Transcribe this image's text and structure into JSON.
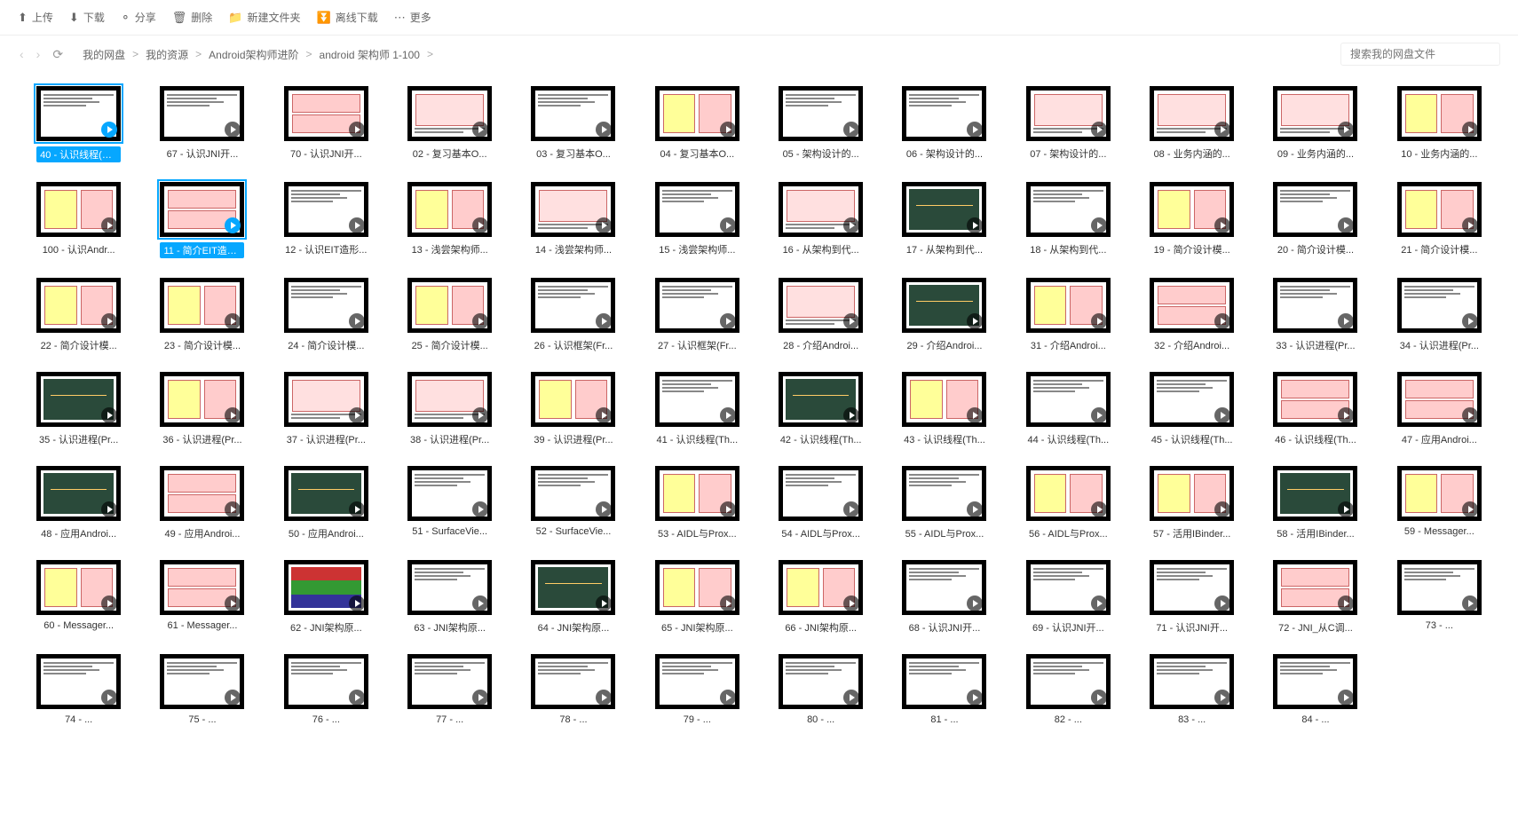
{
  "toolbar": {
    "upload": "上传",
    "download": "下载",
    "share": "分享",
    "delete": "删除",
    "new_folder": "新建文件夹",
    "offline": "离线下载",
    "more": "更多"
  },
  "breadcrumb": [
    "我的网盘",
    "我的资源",
    "Android架构师进阶",
    "android 架构师 1-100"
  ],
  "search_placeholder": "搜索我的网盘文件",
  "selected": [
    "40 - 认识线程(Th...",
    "11 - 简介EIT造形..."
  ],
  "files": [
    {
      "n": "40 - 认识线程(Th...",
      "t": "a",
      "sel": true
    },
    {
      "n": "67 - 认识JNI开...",
      "t": "a"
    },
    {
      "n": "70 - 认识JNI开...",
      "t": "b"
    },
    {
      "n": "02 - 复习基本O...",
      "t": "c"
    },
    {
      "n": "03 - 复习基本O...",
      "t": "a"
    },
    {
      "n": "04 - 复习基本O...",
      "t": "d"
    },
    {
      "n": "05 - 架构设计的...",
      "t": "a"
    },
    {
      "n": "06 - 架构设计的...",
      "t": "a"
    },
    {
      "n": "07 - 架构设计的...",
      "t": "c"
    },
    {
      "n": "08 - 业务内涵的...",
      "t": "c"
    },
    {
      "n": "09 - 业务内涵的...",
      "t": "c"
    },
    {
      "n": "10 - 业务内涵的...",
      "t": "d"
    },
    {
      "n": "100 - 认识Andr...",
      "t": "d"
    },
    {
      "n": "11 - 简介EIT造形...",
      "t": "b",
      "sel": true
    },
    {
      "n": "12 - 认识EIT造形...",
      "t": "a"
    },
    {
      "n": "13 - 浅尝架构师...",
      "t": "d"
    },
    {
      "n": "14 - 浅尝架构师...",
      "t": "c"
    },
    {
      "n": "15 - 浅尝架构师...",
      "t": "a"
    },
    {
      "n": "16 - 从架构到代...",
      "t": "c"
    },
    {
      "n": "17 - 从架构到代...",
      "t": "e"
    },
    {
      "n": "18 - 从架构到代...",
      "t": "a"
    },
    {
      "n": "19 - 简介设计模...",
      "t": "d"
    },
    {
      "n": "20 - 简介设计模...",
      "t": "a"
    },
    {
      "n": "21 - 简介设计模...",
      "t": "d"
    },
    {
      "n": "22 - 简介设计模...",
      "t": "d"
    },
    {
      "n": "23 - 简介设计模...",
      "t": "d"
    },
    {
      "n": "24 - 简介设计模...",
      "t": "a"
    },
    {
      "n": "25 - 简介设计模...",
      "t": "d"
    },
    {
      "n": "26 - 认识框架(Fr...",
      "t": "a"
    },
    {
      "n": "27 - 认识框架(Fr...",
      "t": "a"
    },
    {
      "n": "28 - 介绍Androi...",
      "t": "c"
    },
    {
      "n": "29 - 介绍Androi...",
      "t": "e"
    },
    {
      "n": "31 - 介绍Androi...",
      "t": "d"
    },
    {
      "n": "32 - 介绍Androi...",
      "t": "b"
    },
    {
      "n": "33 - 认识进程(Pr...",
      "t": "a"
    },
    {
      "n": "34 - 认识进程(Pr...",
      "t": "a"
    },
    {
      "n": "35 - 认识进程(Pr...",
      "t": "e"
    },
    {
      "n": "36 - 认识进程(Pr...",
      "t": "d"
    },
    {
      "n": "37 - 认识进程(Pr...",
      "t": "c"
    },
    {
      "n": "38 - 认识进程(Pr...",
      "t": "c"
    },
    {
      "n": "39 - 认识进程(Pr...",
      "t": "d"
    },
    {
      "n": "41 - 认识线程(Th...",
      "t": "a"
    },
    {
      "n": "42 - 认识线程(Th...",
      "t": "e"
    },
    {
      "n": "43 - 认识线程(Th...",
      "t": "d"
    },
    {
      "n": "44 - 认识线程(Th...",
      "t": "a"
    },
    {
      "n": "45 - 认识线程(Th...",
      "t": "a"
    },
    {
      "n": "46 - 认识线程(Th...",
      "t": "b"
    },
    {
      "n": "47 - 应用Androi...",
      "t": "b"
    },
    {
      "n": "48 - 应用Androi...",
      "t": "e"
    },
    {
      "n": "49 - 应用Androi...",
      "t": "b"
    },
    {
      "n": "50 - 应用Androi...",
      "t": "e"
    },
    {
      "n": "51 - SurfaceVie...",
      "t": "a"
    },
    {
      "n": "52 - SurfaceVie...",
      "t": "a"
    },
    {
      "n": "53 - AIDL与Prox...",
      "t": "d"
    },
    {
      "n": "54 - AIDL与Prox...",
      "t": "a"
    },
    {
      "n": "55 - AIDL与Prox...",
      "t": "a"
    },
    {
      "n": "56 - AIDL与Prox...",
      "t": "d"
    },
    {
      "n": "57 - 活用IBinder...",
      "t": "d"
    },
    {
      "n": "58 - 活用IBinder...",
      "t": "e"
    },
    {
      "n": "59 - Messager...",
      "t": "d"
    },
    {
      "n": "60 - Messager...",
      "t": "d"
    },
    {
      "n": "61 - Messager...",
      "t": "b"
    },
    {
      "n": "62 - JNI架构原...",
      "t": "f"
    },
    {
      "n": "63 - JNI架构原...",
      "t": "a"
    },
    {
      "n": "64 - JNI架构原...",
      "t": "e"
    },
    {
      "n": "65 - JNI架构原...",
      "t": "d"
    },
    {
      "n": "66 - JNI架构原...",
      "t": "d"
    },
    {
      "n": "68 - 认识JNI开...",
      "t": "a"
    },
    {
      "n": "69 - 认识JNI开...",
      "t": "a"
    },
    {
      "n": "71 - 认识JNI开...",
      "t": "a"
    },
    {
      "n": "72 - JNI_从C调...",
      "t": "b"
    },
    {
      "n": "73 - ...",
      "t": "a"
    },
    {
      "n": "74 - ...",
      "t": "a"
    },
    {
      "n": "75 - ...",
      "t": "a"
    },
    {
      "n": "76 - ...",
      "t": "a"
    },
    {
      "n": "77 - ...",
      "t": "a"
    },
    {
      "n": "78 - ...",
      "t": "a"
    },
    {
      "n": "79 - ...",
      "t": "a"
    },
    {
      "n": "80 - ...",
      "t": "a"
    },
    {
      "n": "81 - ...",
      "t": "a"
    },
    {
      "n": "82 - ...",
      "t": "a"
    },
    {
      "n": "83 - ...",
      "t": "a"
    },
    {
      "n": "84 - ...",
      "t": "a"
    }
  ]
}
